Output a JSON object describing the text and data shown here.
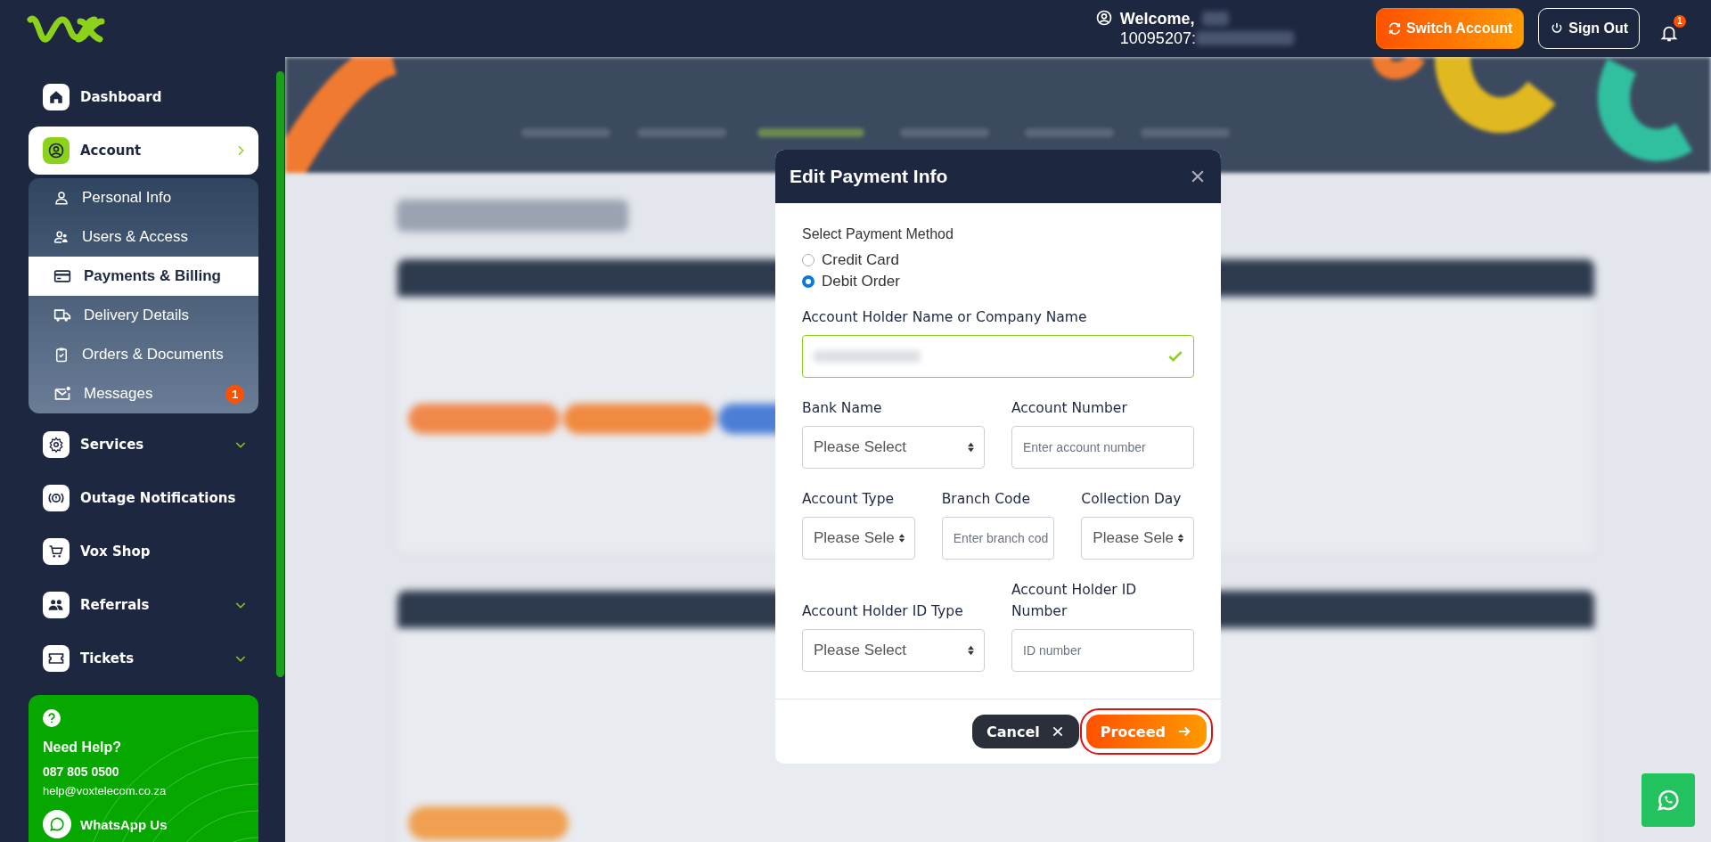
{
  "header": {
    "welcome": "Welcome,",
    "account_id": "10095207:",
    "buttons": [
      {
        "label": "Switch Account",
        "kind": "primary"
      },
      {
        "label": "Sign Out",
        "kind": "outline"
      }
    ],
    "notification_count": "1"
  },
  "sidebar": {
    "items": [
      {
        "label": "Dashboard",
        "selected": false
      },
      {
        "label": "Account",
        "selected": true,
        "expanded": true,
        "children": [
          {
            "label": "Personal Info",
            "selected": false
          },
          {
            "label": "Users & Access",
            "selected": false
          },
          {
            "label": "Payments & Billing",
            "selected": true
          },
          {
            "label": "Delivery Details",
            "selected": false
          },
          {
            "label": "Orders & Documents",
            "selected": false
          },
          {
            "label": "Messages",
            "selected": false,
            "badge": "1"
          }
        ]
      },
      {
        "label": "Services",
        "selected": false,
        "expanded": false
      },
      {
        "label": "Outage Notifications",
        "selected": false
      },
      {
        "label": "Vox Shop",
        "selected": false
      },
      {
        "label": "Referrals",
        "selected": false,
        "expanded": false
      },
      {
        "label": "Tickets",
        "selected": false,
        "expanded": false
      }
    ],
    "help": {
      "title": "Need Help?",
      "phone": "087 805 0500",
      "email": "help@voxtelecom.co.za",
      "whatsapp": "WhatsApp Us"
    }
  },
  "modal": {
    "title": "Edit Payment Info",
    "method_label": "Select Payment Method",
    "methods": [
      {
        "label": "Credit Card",
        "selected": false
      },
      {
        "label": "Debit Order",
        "selected": true
      }
    ],
    "rows": [
      [
        {
          "kind": "text",
          "label": "Account Holder Name or Company Name",
          "valid": true
        }
      ],
      [
        {
          "kind": "select",
          "label": "Bank Name",
          "value": "Please Select"
        },
        {
          "kind": "text",
          "label": "Account Number",
          "placeholder": "Enter account number"
        }
      ],
      [
        {
          "kind": "select",
          "label": "Account Type",
          "value": "Please Sele"
        },
        {
          "kind": "text",
          "label": "Branch Code",
          "placeholder": "Enter branch cod"
        },
        {
          "kind": "select",
          "label": "Collection Day",
          "value": "Please Sele"
        }
      ],
      [
        {
          "kind": "select",
          "label": "Account Holder ID Type",
          "value": "Please Select"
        },
        {
          "kind": "text",
          "label": "Account Holder ID Number",
          "placeholder": "ID number"
        }
      ]
    ],
    "buttons": [
      {
        "label": "Cancel",
        "kind": "secondary",
        "highlighted": false
      },
      {
        "label": "Proceed",
        "kind": "primary",
        "highlighted": true
      }
    ]
  }
}
